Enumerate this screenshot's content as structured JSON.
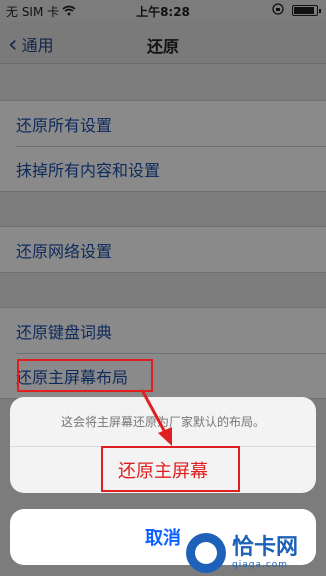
{
  "status_bar": {
    "carrier": "无 SIM 卡",
    "wifi_icon": "wifi-icon",
    "time": "上午8:28",
    "lock_icon": "orientation-lock-icon",
    "battery_icon": "battery-icon"
  },
  "nav": {
    "back_label": "通用",
    "title": "还原"
  },
  "groups": [
    {
      "items": [
        {
          "label": "还原所有设置"
        },
        {
          "label": "抹掉所有内容和设置"
        }
      ]
    },
    {
      "items": [
        {
          "label": "还原网络设置"
        }
      ]
    },
    {
      "items": [
        {
          "label": "还原键盘词典"
        },
        {
          "label": "还原主屏幕布局"
        }
      ]
    }
  ],
  "action_sheet": {
    "message": "这会将主屏幕还原为厂家默认的布局。",
    "confirm_label": "还原主屏幕",
    "cancel_label": "取消"
  },
  "annotation_color": "#e02020",
  "watermark": {
    "name": "恰卡网",
    "url": "qiaqa.com"
  }
}
